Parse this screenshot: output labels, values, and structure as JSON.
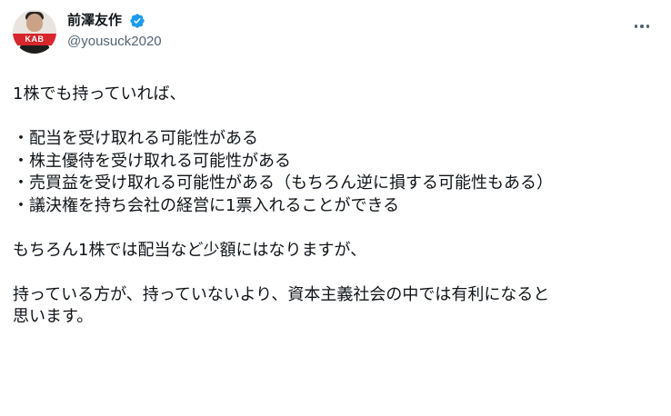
{
  "author": {
    "display_name": "前澤友作",
    "handle": "@yousuck2020",
    "verified_color": "#1d9bf0",
    "avatar_badge_text": "KAB"
  },
  "menu": {
    "more_icon": "more-dots-icon"
  },
  "tweet": {
    "lines": [
      "1株でも持っていれば、",
      "",
      "・配当を受け取れる可能性がある",
      "・株主優待を受け取れる可能性がある",
      "・売買益を受け取れる可能性がある（もちろん逆に損する可能性もある）",
      "・議決権を持ち会社の経営に1票入れることができる",
      "",
      "もちろん1株では配当など少額にはなりますが、",
      "",
      "持っている方が、持っていないより、資本主義社会の中では有利になると",
      "思います。"
    ]
  }
}
